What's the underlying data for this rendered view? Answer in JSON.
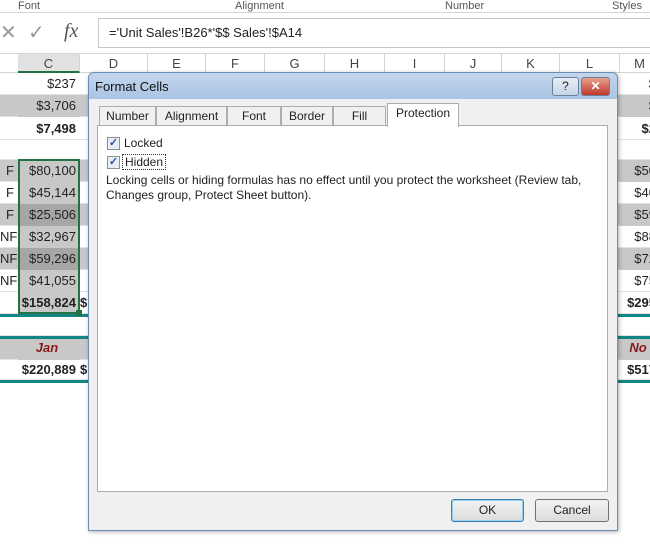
{
  "ribbon": {
    "groups": [
      "Font",
      "Alignment",
      "Number",
      "Styles"
    ]
  },
  "formula_bar": {
    "fx": "fx",
    "cancel": "✕",
    "enter": "✓",
    "value": "='Unit Sales'!B26*'$$ Sales'!$A14"
  },
  "columns": [
    "C",
    "D",
    "E",
    "F",
    "G",
    "H",
    "I",
    "J",
    "K",
    "L",
    "M"
  ],
  "sheet": {
    "rows": [
      {
        "a": "",
        "c": "$237",
        "m": "$"
      },
      {
        "a": "",
        "c": "$3,706",
        "m": "$"
      },
      {
        "a": "",
        "c": "$7,498",
        "m": "$2"
      },
      {
        "a": "",
        "c": "",
        "m": ""
      },
      {
        "a": "F",
        "c": "$80,100",
        "m": "$50"
      },
      {
        "a": "F",
        "c": "$45,144",
        "m": "$40"
      },
      {
        "a": "F",
        "c": "$25,506",
        "m": "$59"
      },
      {
        "a": "NF",
        "c": "$32,967",
        "m": "$88"
      },
      {
        "a": "NF",
        "c": "$59,296",
        "m": "$72"
      },
      {
        "a": "NF",
        "c": "$41,055",
        "m": "$75"
      },
      {
        "a": "",
        "c": "$158,824",
        "d": "$",
        "m": "$295"
      },
      {
        "a": "",
        "c": "",
        "m": ""
      },
      {
        "a": "",
        "c": "Jan",
        "m": "No"
      },
      {
        "a": "",
        "c": "$220,889",
        "d": "$",
        "m": "$517"
      }
    ]
  },
  "dialog": {
    "title": "Format Cells",
    "help": "?",
    "close": "✕",
    "tabs": [
      "Number",
      "Alignment",
      "Font",
      "Border",
      "Fill",
      "Protection"
    ],
    "active_tab": "Protection",
    "locked": {
      "label": "Locked",
      "checked": true
    },
    "hidden": {
      "label": "Hidden",
      "checked": true
    },
    "description": "Locking cells or hiding formulas has no effect until you protect the worksheet (Review tab, Changes group, Protect Sheet button).",
    "ok": "OK",
    "cancel": "Cancel"
  }
}
